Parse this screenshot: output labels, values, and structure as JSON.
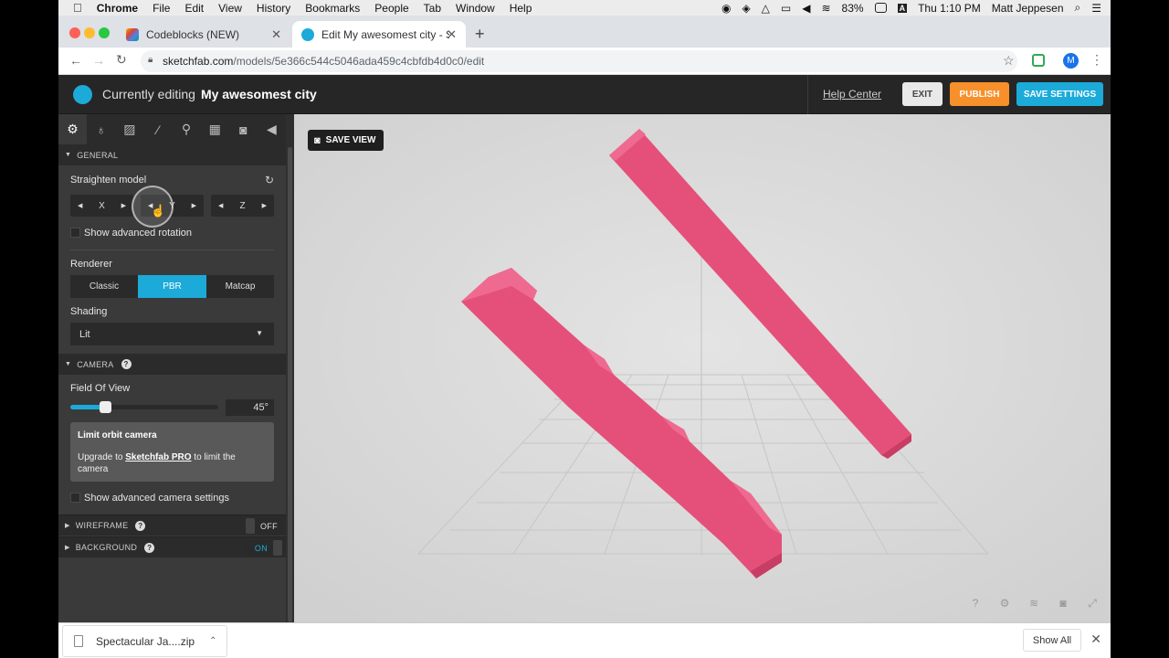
{
  "menubar": {
    "apple": "",
    "app": "Chrome",
    "items": [
      "File",
      "Edit",
      "View",
      "History",
      "Bookmarks",
      "People",
      "Tab",
      "Window",
      "Help"
    ],
    "battery": "83%",
    "clock": "Thu 1:10 PM",
    "user": "Matt Jeppesen"
  },
  "tabs": {
    "tab1": "Codeblocks (NEW)",
    "tab2": "Edit My awesomest city - Sketchfab",
    "new_tab": "+"
  },
  "address": {
    "host": "sketchfab.com",
    "path": "/models/5e366c544c5046ada459c4cbfdb4d0c0/edit",
    "avatar_letter": "M"
  },
  "header": {
    "editing_label": "Currently editing",
    "model_name": "My awesomest city",
    "help_center": "Help Center",
    "exit": "EXIT",
    "publish": "PUBLISH",
    "save_settings": "SAVE SETTINGS"
  },
  "colors": {
    "accent": "#1caad9",
    "publish": "#f7902b",
    "model": "#e5507a"
  },
  "panel": {
    "general": {
      "title": "GENERAL",
      "straighten": "Straighten model",
      "axes": [
        "X",
        "Y",
        "Z"
      ],
      "advanced_rotation": "Show advanced rotation",
      "renderer_label": "Renderer",
      "renderers": [
        "Classic",
        "PBR",
        "Matcap"
      ],
      "renderer_selected": "PBR",
      "shading_label": "Shading",
      "shading_value": "Lit"
    },
    "camera": {
      "title": "CAMERA",
      "fov_label": "Field Of View",
      "fov_value": "45°",
      "fov_fraction": 0.2,
      "limit_title": "Limit orbit camera",
      "limit_text_pre": "Upgrade to ",
      "limit_link": "Sketchfab PRO",
      "limit_text_post": " to limit the camera",
      "advanced": "Show advanced camera settings"
    },
    "wireframe": {
      "title": "WIREFRAME",
      "state": "OFF"
    },
    "background": {
      "title": "BACKGROUND",
      "state": "ON"
    }
  },
  "viewport": {
    "save_view": "SAVE VIEW"
  },
  "downloads": {
    "file": "Spectacular Ja....zip",
    "show_all": "Show All"
  }
}
